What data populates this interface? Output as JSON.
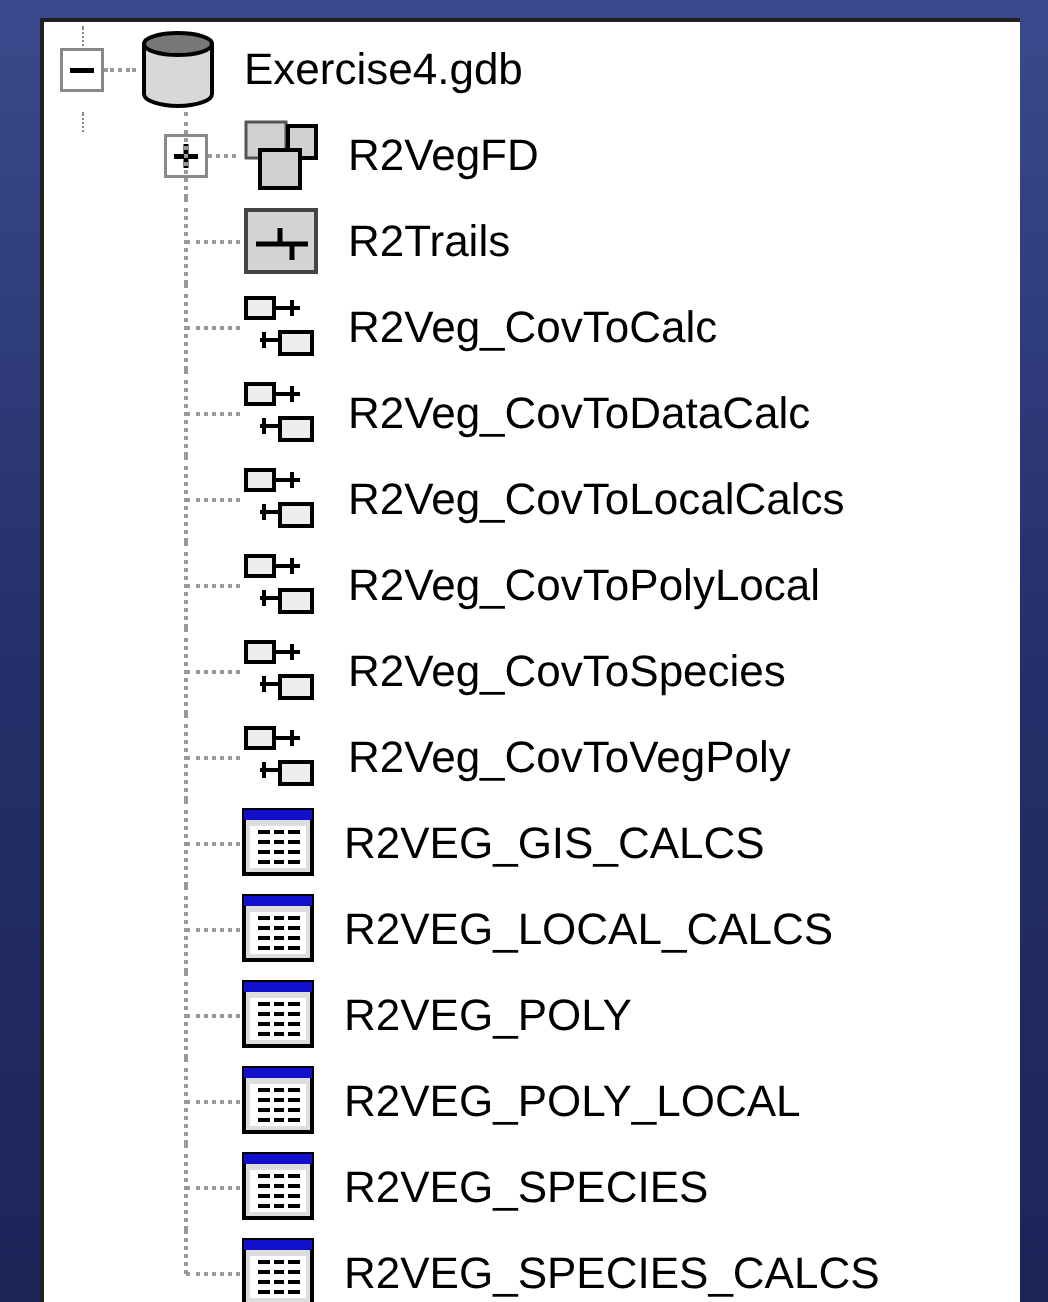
{
  "tree": {
    "label": "Exercise4.gdb",
    "kind": "geodatabase",
    "expanded": true,
    "children": [
      {
        "label": "R2VegFD",
        "kind": "feature_dataset",
        "expanded": false
      },
      {
        "label": "R2Trails",
        "kind": "feature_class"
      },
      {
        "label": "R2Veg_CovToCalc",
        "kind": "relationship"
      },
      {
        "label": "R2Veg_CovToDataCalc",
        "kind": "relationship"
      },
      {
        "label": "R2Veg_CovToLocalCalcs",
        "kind": "relationship"
      },
      {
        "label": "R2Veg_CovToPolyLocal",
        "kind": "relationship"
      },
      {
        "label": "R2Veg_CovToSpecies",
        "kind": "relationship"
      },
      {
        "label": "R2Veg_CovToVegPoly",
        "kind": "relationship"
      },
      {
        "label": "R2VEG_GIS_CALCS",
        "kind": "table"
      },
      {
        "label": "R2VEG_LOCAL_CALCS",
        "kind": "table"
      },
      {
        "label": "R2VEG_POLY",
        "kind": "table"
      },
      {
        "label": "R2VEG_POLY_LOCAL",
        "kind": "table"
      },
      {
        "label": "R2VEG_SPECIES",
        "kind": "table"
      },
      {
        "label": "R2VEG_SPECIES_CALCS",
        "kind": "table"
      }
    ]
  }
}
